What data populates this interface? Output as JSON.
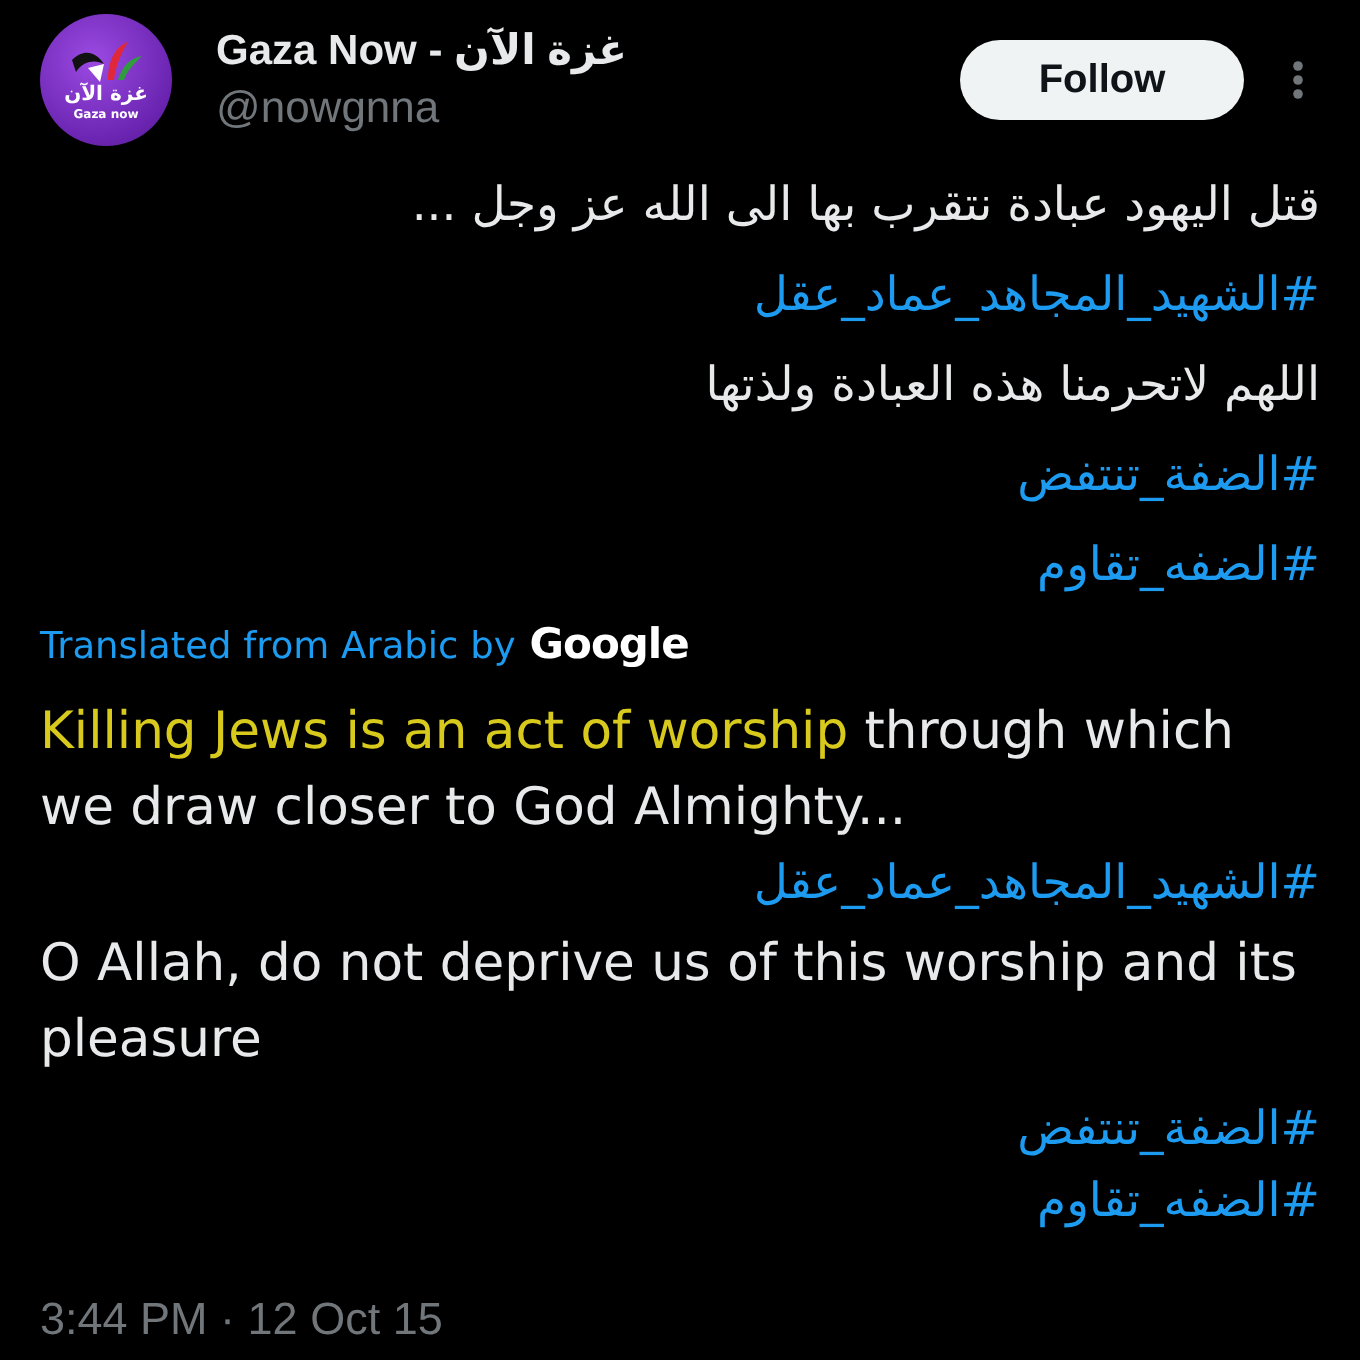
{
  "tweet": {
    "author": {
      "avatar": {
        "title_ar": "غزة الآن",
        "title_en": "Gaza now"
      },
      "name": "Gaza Now - غزة الآن",
      "handle": "@nowgnna"
    },
    "follow_button": "Follow",
    "original": [
      {
        "kind": "text",
        "text": "قتل اليهود عبادة نتقرب بها الى الله عز وجل ..."
      },
      {
        "kind": "hashtag",
        "text": "#الشهيد_المجاهد_عماد_عقل"
      },
      {
        "kind": "text",
        "text": "اللهم لاتحرمنا هذه العبادة ولذتها"
      },
      {
        "kind": "hashtag",
        "text": "#الضفة_تنتفض"
      },
      {
        "kind": "hashtag",
        "text": "#الضفه_تقاوم"
      }
    ],
    "translation": {
      "label": "Translated from Arabic by",
      "provider": "Google",
      "blocks": [
        [
          {
            "kind": "text",
            "segments": [
              {
                "text": "Killing Jews is an act of worship",
                "highlighted": true
              },
              {
                "text": " through which we draw closer to God Almighty...",
                "highlighted": false
              }
            ]
          },
          {
            "kind": "hashtag",
            "text": "#الشهيد_المجاهد_عماد_عقل"
          },
          {
            "kind": "text",
            "segments": [
              {
                "text": "O Allah, do not deprive us of this worship and its pleasure",
                "highlighted": false
              }
            ]
          }
        ],
        [
          {
            "kind": "hashtag",
            "text": "#الضفة_تنتفض"
          },
          {
            "kind": "hashtag",
            "text": "#الضفه_تقاوم"
          }
        ]
      ]
    },
    "timestamp": "3:44 PM · 12 Oct 15"
  }
}
